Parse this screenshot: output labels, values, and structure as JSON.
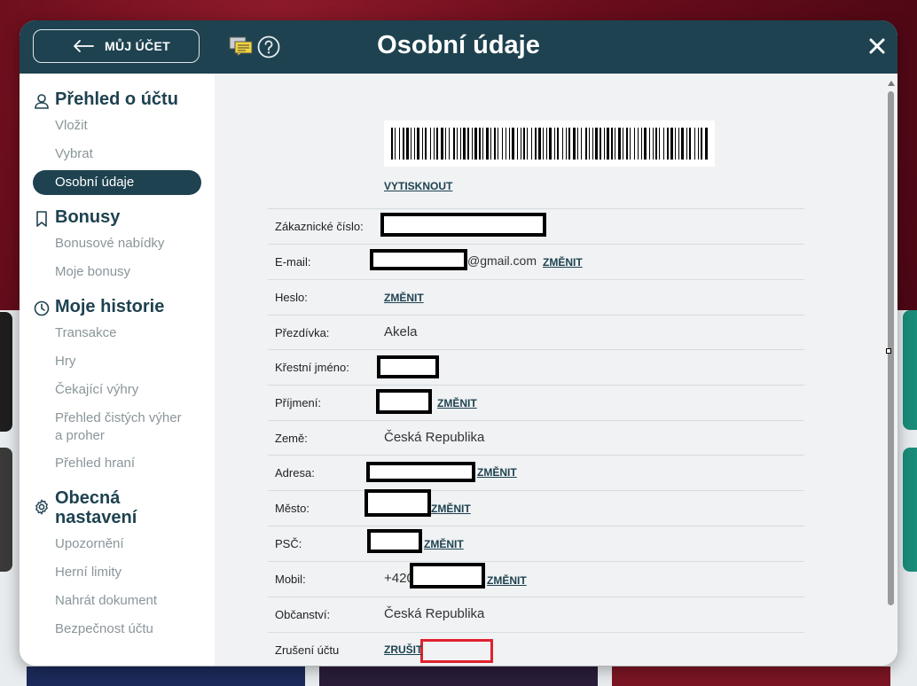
{
  "header": {
    "back_label": "MŮJ ÚČET",
    "title": "Osobní údaje"
  },
  "sidebar": {
    "sections": [
      {
        "title": "Přehled o účtu",
        "icon": "user-icon",
        "items": [
          "Vložit",
          "Vybrat",
          "Osobní údaje"
        ],
        "active": "Osobní údaje"
      },
      {
        "title": "Bonusy",
        "icon": "bookmark-icon",
        "items": [
          "Bonusové nabídky",
          "Moje bonusy"
        ]
      },
      {
        "title": "Moje historie",
        "icon": "clock-icon",
        "items": [
          "Transakce",
          "Hry",
          "Čekající výhry",
          "Přehled čistých výher a proher",
          "Přehled hraní"
        ]
      },
      {
        "title": "Obecná nastavení",
        "icon": "gear-icon",
        "items": [
          "Upozornění",
          "Herní limity",
          "Nahrát dokument",
          "Bezpečnost účtu"
        ]
      }
    ]
  },
  "content": {
    "print_label": "VYTISKNOUT",
    "change_label": "ZMĚNIT",
    "rows": [
      {
        "label": "Zákaznické číslo:",
        "value": ""
      },
      {
        "label": "E-mail:",
        "value": "@gmail.com"
      },
      {
        "label": "Heslo:",
        "value": ""
      },
      {
        "label": "Přezdívka:",
        "value": "Akela"
      },
      {
        "label": "Křestní jméno:",
        "value": ""
      },
      {
        "label": "Příjmení:",
        "value": ""
      },
      {
        "label": "Země:",
        "value": "Česká Republika"
      },
      {
        "label": "Adresa:",
        "value": ""
      },
      {
        "label": "Město:",
        "value": ""
      },
      {
        "label": "PSČ:",
        "value": ""
      },
      {
        "label": "Mobil:",
        "value": "+420"
      },
      {
        "label": "Občanství:",
        "value": "Česká Republika"
      },
      {
        "label": "Zrušení účtu",
        "value": ""
      }
    ],
    "cancel_label": "ZRUŠIT"
  },
  "colors": {
    "header_bg": "#1e4250",
    "accent": "#1e4250",
    "cancel_border": "#e0222f",
    "muted_text": "#8a9599"
  }
}
